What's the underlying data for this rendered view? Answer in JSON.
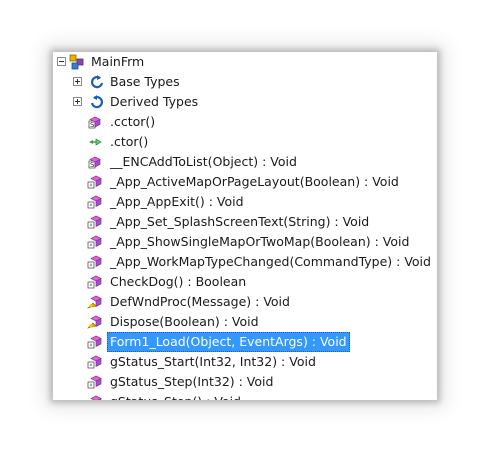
{
  "tree": {
    "root": {
      "label": "MainFrm",
      "icon": "class-icon"
    },
    "groups": [
      {
        "label": "Base Types",
        "icon": "base-types-icon"
      },
      {
        "label": "Derived Types",
        "icon": "derived-types-icon"
      }
    ],
    "members": [
      {
        "label": ".cctor()",
        "icon": "static-method-icon"
      },
      {
        "label": ".ctor()",
        "icon": "constructor-icon"
      },
      {
        "label": "__ENCAddToList(Object) : Void",
        "icon": "static-method-icon"
      },
      {
        "label": "_App_ActiveMapOrPageLayout(Boolean) : Void",
        "icon": "method-icon"
      },
      {
        "label": "_App_AppExit() : Void",
        "icon": "method-icon"
      },
      {
        "label": "_App_Set_SplashScreenText(String) : Void",
        "icon": "method-icon"
      },
      {
        "label": "_App_ShowSingleMapOrTwoMap(Boolean) : Void",
        "icon": "method-icon"
      },
      {
        "label": "_App_WorkMapTypeChanged(CommandType) : Void",
        "icon": "method-icon"
      },
      {
        "label": "CheckDog() : Boolean",
        "icon": "method-icon"
      },
      {
        "label": "DefWndProc(Message) : Void",
        "icon": "protected-method-icon"
      },
      {
        "label": "Dispose(Boolean) : Void",
        "icon": "protected-method-icon"
      },
      {
        "label": "Form1_Load(Object, EventArgs) : Void",
        "icon": "method-icon",
        "selected": true
      },
      {
        "label": "gStatus_Start(Int32, Int32) : Void",
        "icon": "method-icon"
      },
      {
        "label": "gStatus_Step(Int32) : Void",
        "icon": "method-icon"
      },
      {
        "label": "gStatus_Stop() : Void",
        "icon": "method-icon"
      }
    ]
  },
  "colors": {
    "selection": "#3399ff",
    "method_purple": "#a64dcf",
    "method_pink": "#e75fd1",
    "tree_blue": "#1f5fb3"
  }
}
